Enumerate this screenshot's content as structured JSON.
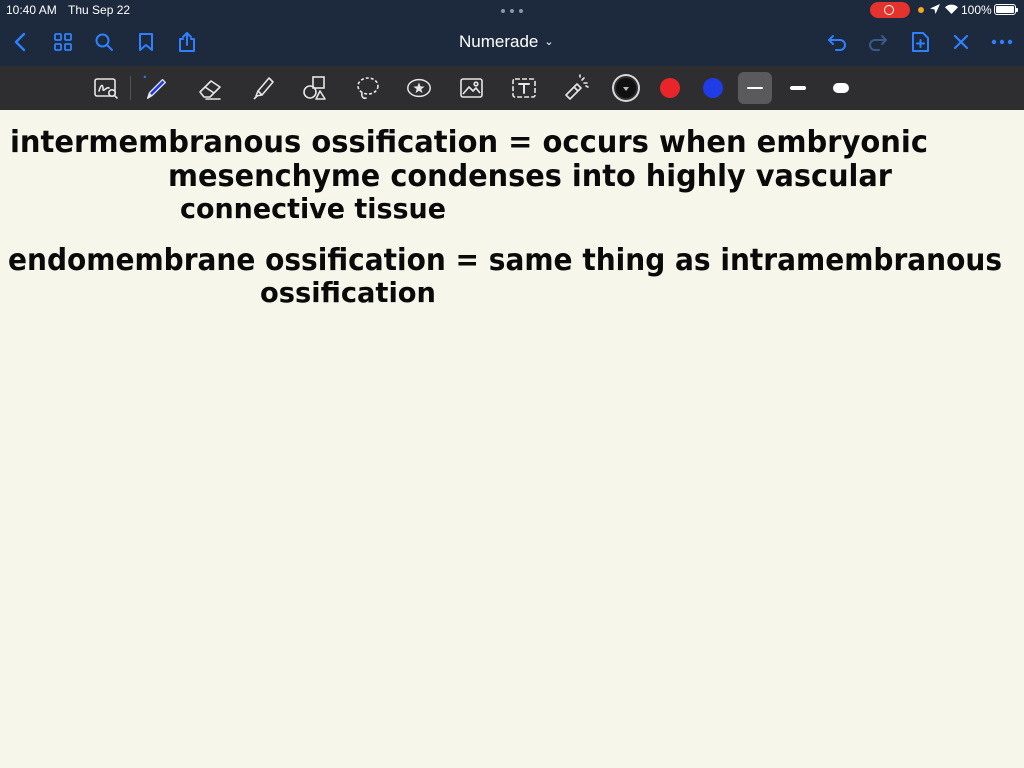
{
  "status_bar": {
    "time": "10:40 AM",
    "date": "Thu Sep 22",
    "battery": "100%",
    "icons": [
      "screen-record-icon",
      "location-icon",
      "wifi-icon",
      "battery-icon"
    ]
  },
  "nav_bar": {
    "title": "Numerade",
    "left_icons": [
      "back-icon",
      "grid-icon",
      "search-icon",
      "bookmark-icon",
      "share-icon"
    ],
    "right_icons": [
      "undo-icon",
      "redo-icon",
      "add-page-icon",
      "close-icon",
      "more-icon"
    ]
  },
  "toolbar": {
    "tools": [
      "zoom-window-icon",
      "pen-icon",
      "eraser-icon",
      "highlighter-icon",
      "shapes-icon",
      "lasso-icon",
      "elements-icon",
      "image-icon",
      "text-icon",
      "laser-pointer-icon"
    ],
    "selected_tool": "pen-icon",
    "colors": [
      "#111111",
      "#e8262a",
      "#1f3ce6"
    ],
    "selected_color": "#111111",
    "stroke_widths": [
      "thin",
      "medium",
      "thick"
    ],
    "selected_stroke": "thin"
  },
  "note": {
    "lines": [
      "intermembranous ossification = occurs when embryonic",
      "mesenchyme condenses into highly vascular",
      "connective tissue",
      "endomembrane ossification = same thing as intramembranous",
      "ossification"
    ]
  }
}
